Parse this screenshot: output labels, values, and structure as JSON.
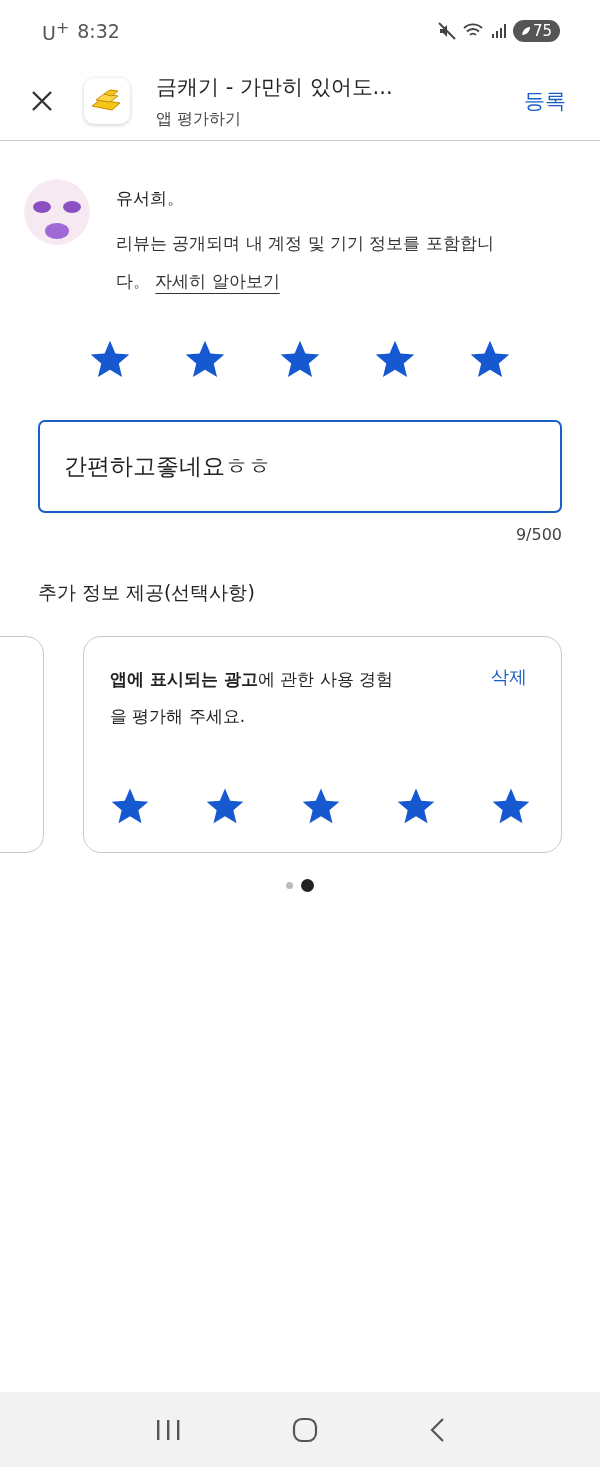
{
  "status_bar": {
    "carrier": "U$^{+}$",
    "time": "8:32",
    "battery": "75"
  },
  "header": {
    "title": "금캐기 - 가만히 있어도...",
    "subtitle": "앱 평가하기",
    "action": "등록"
  },
  "user": {
    "name": "유서희。",
    "notice": "리뷰는 공개되며 내 계정 및 기기 정보를 포함합니다。",
    "link": "자세히 알아보기"
  },
  "rating": {
    "stars": 5
  },
  "review": {
    "value": "간편하고좋네요ㅎㅎ",
    "counter": "9/500"
  },
  "extra": {
    "heading": "추가 정보 제공(선택사항)",
    "cards": [
      {
        "partial": true
      },
      {
        "partial": false,
        "question": "**앱에 표시되는 광고**에 관한 사용 경험을 평가해 주세요.",
        "action": "삭제",
        "stars": 5
      }
    ],
    "pager": [
      {
        "selected": false
      },
      {
        "selected": true
      }
    ]
  }
}
